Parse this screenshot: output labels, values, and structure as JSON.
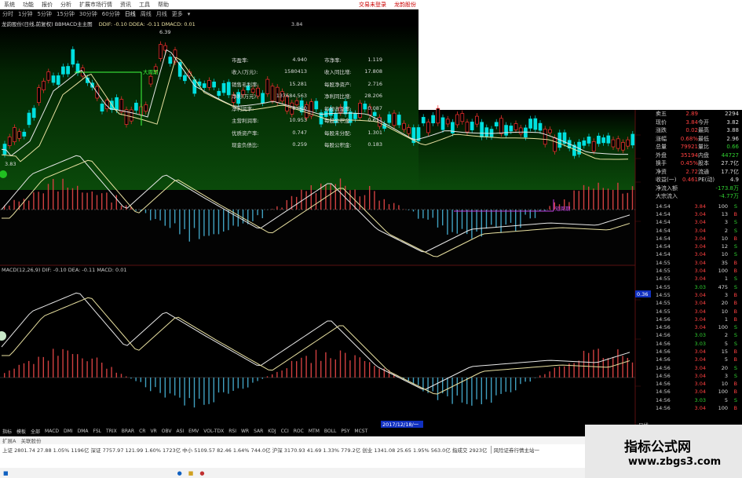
{
  "menubar": {
    "items": [
      "系统",
      "功能",
      "报价",
      "分析",
      "扩展市场行情",
      "资讯",
      "工具",
      "帮助"
    ],
    "right_items": [
      "交易未登录",
      "龙韵股份"
    ]
  },
  "periods": {
    "items": [
      "分时",
      "1分钟",
      "5分钟",
      "15分钟",
      "30分钟",
      "60分钟",
      "日线",
      "周线",
      "月线",
      "更多"
    ],
    "active": "日线"
  },
  "main_chart": {
    "title": "龙韵股份(日线,前复权) BBMACD主主图",
    "indicators": "DDIF: -0.10  DDEA: -0.11  DMACD: 0.01",
    "right_value": "3.84",
    "high_label": "6.39",
    "low_label": "3.83",
    "annotation_1": "大周期",
    "annotation_2": "短周期"
  },
  "fin_table": [
    {
      "label": "市盈率:",
      "value": "4.940",
      "label2": "市净率:",
      "value2": "1.119"
    },
    {
      "label": "收入(万元):",
      "value": "1580413",
      "label2": "收入同比增:",
      "value2": "17.808"
    },
    {
      "label": "销售毛利率:",
      "value": "15.281",
      "label2": "每股净资产:",
      "value2": "2.716"
    },
    {
      "label": "净利(万元):",
      "value": "137684.563",
      "label2": "净利同比增:",
      "value2": "28.206"
    },
    {
      "label": "净利润率:",
      "value": "8.000",
      "label2": "每股收益率:",
      "value2": "0.087"
    },
    {
      "label": "主营利润率:",
      "value": "10.953",
      "label2": "每股公积金:",
      "value2": "0.611"
    },
    {
      "label": "优质资产率:",
      "value": "0.747",
      "label2": "每股未分配:",
      "value2": "1.301"
    },
    {
      "label": "现金负债比:",
      "value": "0.259",
      "label2": "每股公积金:",
      "value2": "0.183"
    }
  ],
  "macd_panel": {
    "label": "MACD(12,26,9)  DIF: -0.10  DEA: -0.11  MACD: 0.01",
    "right_value": "0.36"
  },
  "x_axis": {
    "date_label": "2017/12/18/一"
  },
  "quote": [
    {
      "k1": "卖五",
      "v1": "2.89",
      "k2": "",
      "v2": "2294"
    },
    {
      "k1": "现价",
      "v1": "3.84",
      "k2": "今开",
      "v2": "3.82"
    },
    {
      "k1": "涨跌",
      "v1": "0.02",
      "k2": "最高",
      "v2": "3.88"
    },
    {
      "k1": "涨幅",
      "v1": "0.68%",
      "k2": "最低",
      "v2": "2.96"
    },
    {
      "k1": "总量",
      "v1": "79921",
      "k2": "量比",
      "v2": "0.66"
    },
    {
      "k1": "外盘",
      "v1": "35194",
      "k2": "内盘",
      "v2": "44727"
    },
    {
      "k1": "换手",
      "v1": "0.45%",
      "k2": "股本",
      "v2": "27.7亿"
    },
    {
      "k1": "净资",
      "v1": "2.72",
      "k2": "流通",
      "v2": "17.7亿"
    },
    {
      "k1": "收益(一)",
      "v1": "0.461",
      "k2": "PE(动)",
      "v2": "4.9"
    },
    {
      "k1": "净流入额",
      "v1": "",
      "k2": "",
      "v2": "-173.8万"
    },
    {
      "k1": "大宗流入",
      "v1": "",
      "k2": "",
      "v2": "-4.77万"
    }
  ],
  "ticks": [
    {
      "t": "14:54",
      "p": "3.84",
      "v": "100",
      "d": "S"
    },
    {
      "t": "14:54",
      "p": "3.04",
      "v": "13",
      "d": "B"
    },
    {
      "t": "14:54",
      "p": "3.04",
      "v": "3",
      "d": "S"
    },
    {
      "t": "14:54",
      "p": "3.04",
      "v": "2",
      "d": "S"
    },
    {
      "t": "14:54",
      "p": "3.04",
      "v": "10",
      "d": "B"
    },
    {
      "t": "14:54",
      "p": "3.04",
      "v": "12",
      "d": "S"
    },
    {
      "t": "14:54",
      "p": "3.04",
      "v": "10",
      "d": "S"
    },
    {
      "t": "14:55",
      "p": "3.04",
      "v": "35",
      "d": "B"
    },
    {
      "t": "14:55",
      "p": "3.04",
      "v": "100",
      "d": "B"
    },
    {
      "t": "14:55",
      "p": "3.04",
      "v": "1",
      "d": "S"
    },
    {
      "t": "14:55",
      "p": "3.03",
      "v": "475",
      "d": "S"
    },
    {
      "t": "14:55",
      "p": "3.04",
      "v": "3",
      "d": "B"
    },
    {
      "t": "14:55",
      "p": "3.04",
      "v": "20",
      "d": "B"
    },
    {
      "t": "14:55",
      "p": "3.04",
      "v": "10",
      "d": "B"
    },
    {
      "t": "14:56",
      "p": "3.04",
      "v": "1",
      "d": "B"
    },
    {
      "t": "14:56",
      "p": "3.04",
      "v": "100",
      "d": "S"
    },
    {
      "t": "14:56",
      "p": "3.03",
      "v": "2",
      "d": "S"
    },
    {
      "t": "14:56",
      "p": "3.03",
      "v": "5",
      "d": "S"
    },
    {
      "t": "14:56",
      "p": "3.04",
      "v": "15",
      "d": "B"
    },
    {
      "t": "14:56",
      "p": "3.04",
      "v": "5",
      "d": "B"
    },
    {
      "t": "14:56",
      "p": "3.04",
      "v": "20",
      "d": "S"
    },
    {
      "t": "14:56",
      "p": "3.04",
      "v": "3",
      "d": "S"
    },
    {
      "t": "14:56",
      "p": "3.04",
      "v": "10",
      "d": "B"
    },
    {
      "t": "14:56",
      "p": "3.04",
      "v": "100",
      "d": "B"
    },
    {
      "t": "14:56",
      "p": "3.03",
      "v": "5",
      "d": "S"
    },
    {
      "t": "14:56",
      "p": "3.04",
      "v": "100",
      "d": "B"
    }
  ],
  "bottom_tabs": [
    "指标",
    "模板",
    "全部",
    "MACD",
    "DMI",
    "DMA",
    "FSL",
    "TRIX",
    "BRAR",
    "CR",
    "VR",
    "OBV",
    "ASI",
    "EMV",
    "VOL-TDX",
    "RSI",
    "WR",
    "SAR",
    "KDJ",
    "CCI",
    "ROC",
    "MTM",
    "BOLL",
    "PSY",
    "MCST"
  ],
  "bottom_right": "日线",
  "sub_tabs": [
    "扩展A",
    "关联股份"
  ],
  "statusbar": {
    "line1": "上证 2801.74  27.88  1.05%  1196亿  深证 7757.97  121.99  1.60%  1723亿  中小 5109.57  82.46  1.64%  744.0亿  沪深 3170.93  41.69  1.33%  779.2亿  创业 1341.08  25.65  1.95%  563.0亿  指成交  2923亿",
    "line2": "风险证券行情主站一"
  },
  "watermark": {
    "title": "指标公式网",
    "url": "www.zbgs3.com"
  },
  "colors": {
    "up": "#ff3030",
    "down": "#00e0e0",
    "line_white": "#e8e8e8",
    "line_yellow": "#e8e0a0",
    "macd_up": "#d04040",
    "macd_down": "#40a0c0",
    "purple": "#a040c0"
  }
}
